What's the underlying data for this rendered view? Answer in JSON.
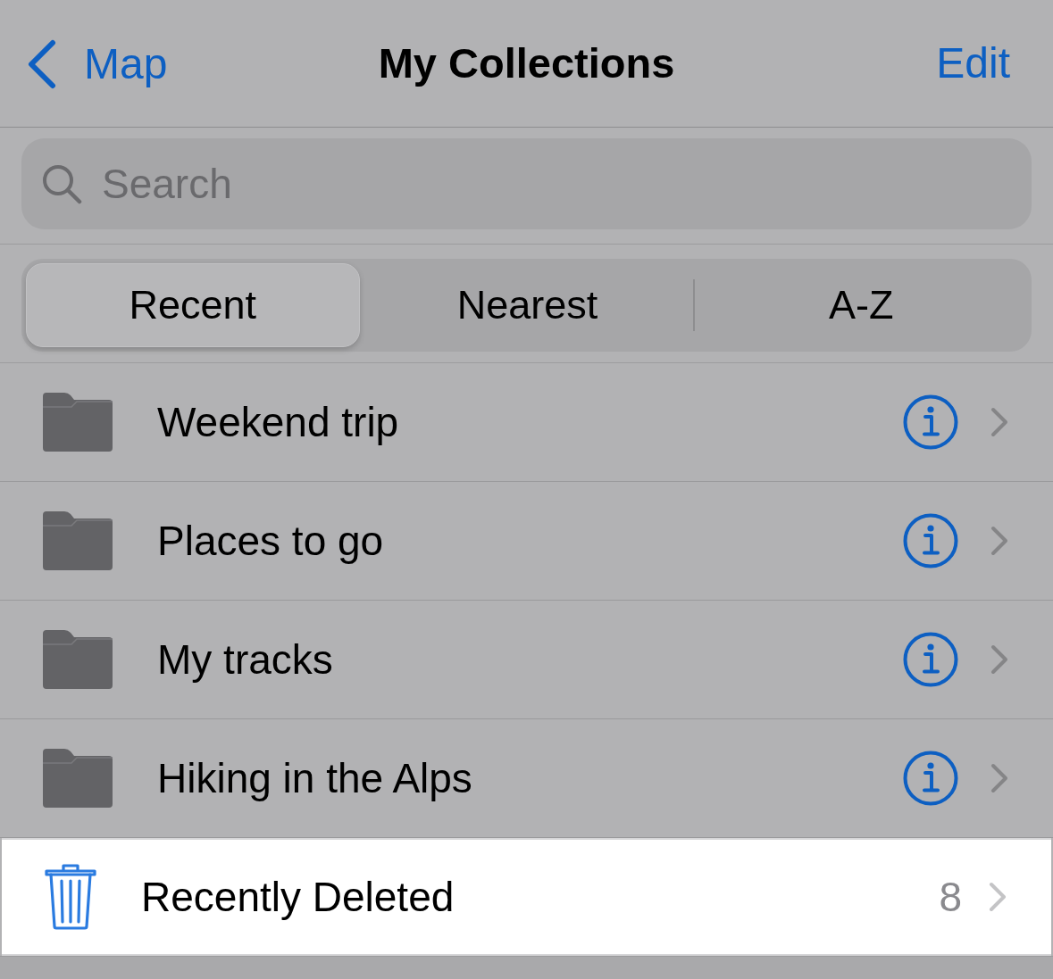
{
  "nav_bar": {
    "back_label": "Map",
    "title": "My Collections",
    "action": "Edit"
  },
  "search": {
    "placeholder": "Search"
  },
  "sort_tabs": [
    {
      "label": "Recent",
      "selected": true
    },
    {
      "label": "Nearest",
      "selected": false
    },
    {
      "label": "A-Z",
      "selected": false
    }
  ],
  "collections": [
    {
      "name": "Weekend trip"
    },
    {
      "name": "Places to go"
    },
    {
      "name": "My tracks"
    },
    {
      "name": "Hiking in the Alps"
    }
  ],
  "recently_deleted": {
    "label": "Recently Deleted",
    "count": "8",
    "highlighted": true
  }
}
